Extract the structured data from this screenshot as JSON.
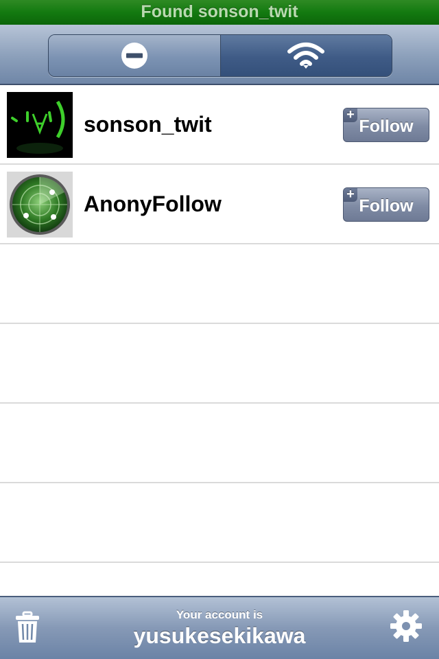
{
  "status": {
    "text": "Found sonson_twit",
    "color": "#137a10"
  },
  "toolbar": {
    "segments": [
      {
        "icon": "minus-circle-icon",
        "selected": false
      },
      {
        "icon": "wifi-icon",
        "selected": true
      }
    ]
  },
  "users": [
    {
      "name": "sonson_twit",
      "avatar": "emoticon-face-avatar",
      "button_label": "Follow",
      "badge": "+"
    },
    {
      "name": "AnonyFollow",
      "avatar": "radar-avatar",
      "button_label": "Follow",
      "badge": "+"
    }
  ],
  "footer": {
    "caption": "Your account is",
    "account": "yusukesekikawa",
    "left_icon": "trash-icon",
    "right_icon": "gear-icon"
  },
  "colors": {
    "accent": "#3f5b86",
    "status_green": "#137a10",
    "button": "#7f8ba4"
  }
}
